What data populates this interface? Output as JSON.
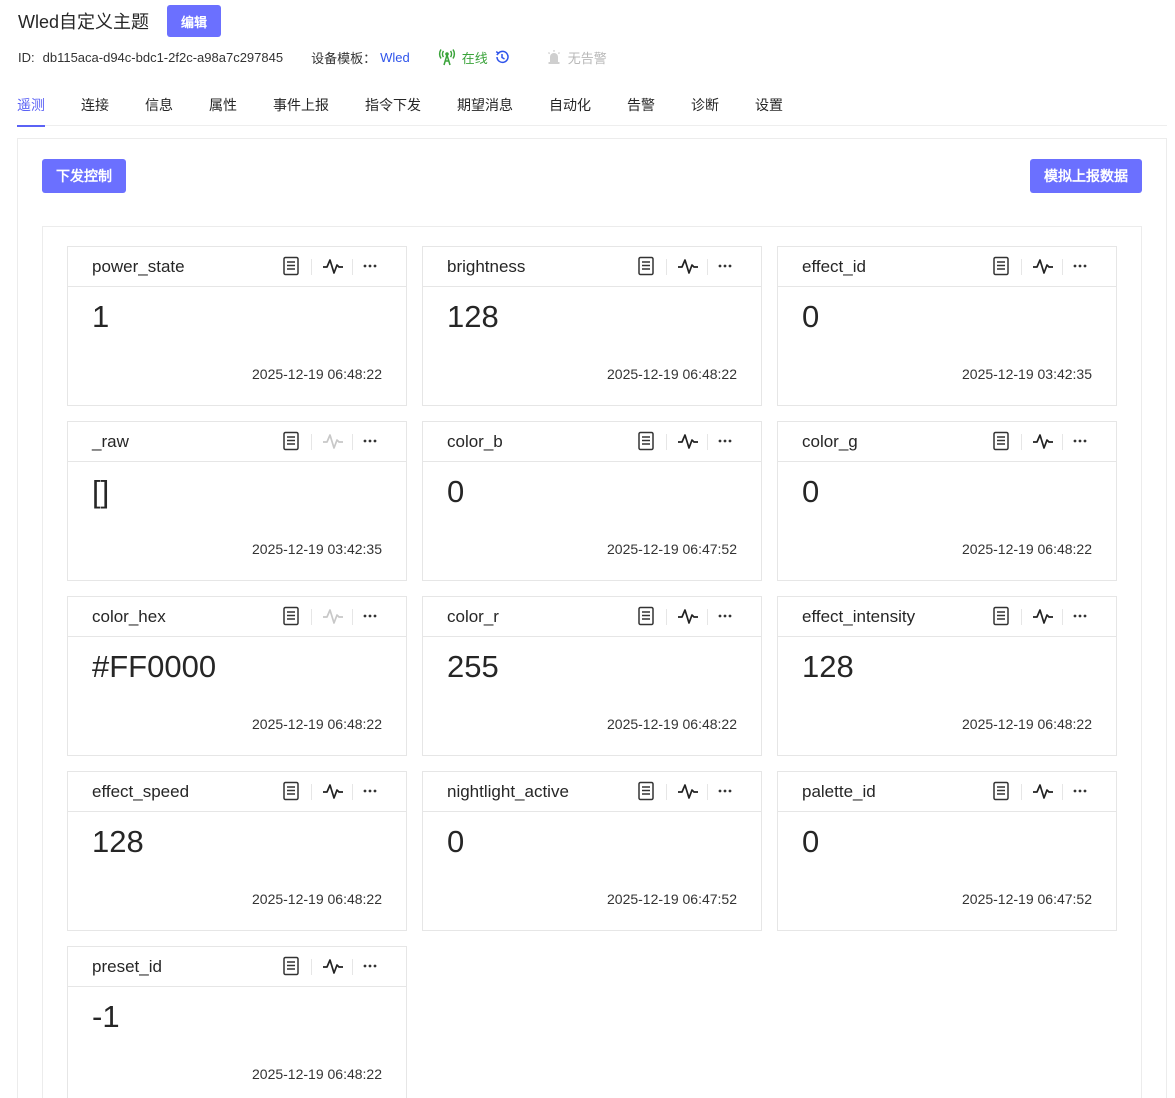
{
  "header": {
    "title": "Wled自定义主题",
    "edit_label": "编辑"
  },
  "meta": {
    "id_label": "ID:",
    "id_value": "db115aca-d94c-bdc1-2f2c-a98a7c297845",
    "template_label": "设备模板：",
    "template_value": "Wled",
    "online_label": "在线",
    "alarm_label": "无告警",
    "colors": {
      "accent": "#6b70ff",
      "online": "#3aa33a",
      "link": "#2f54eb",
      "muted": "#b8b8b8"
    }
  },
  "tabs": [
    {
      "label": "遥测",
      "active": true
    },
    {
      "label": "连接"
    },
    {
      "label": "信息"
    },
    {
      "label": "属性"
    },
    {
      "label": "事件上报"
    },
    {
      "label": "指令下发"
    },
    {
      "label": "期望消息"
    },
    {
      "label": "自动化"
    },
    {
      "label": "告警"
    },
    {
      "label": "诊断"
    },
    {
      "label": "设置"
    }
  ],
  "actions": {
    "send_control": "下发控制",
    "simulate_report": "模拟上报数据"
  },
  "cards": [
    {
      "name": "power_state",
      "value": "1",
      "time": "2025-12-19 06:48:22",
      "chart_enabled": true
    },
    {
      "name": "brightness",
      "value": "128",
      "time": "2025-12-19 06:48:22",
      "chart_enabled": true
    },
    {
      "name": "effect_id",
      "value": "0",
      "time": "2025-12-19 03:42:35",
      "chart_enabled": true
    },
    {
      "name": "_raw",
      "value": "[]",
      "time": "2025-12-19 03:42:35",
      "chart_enabled": false
    },
    {
      "name": "color_b",
      "value": "0",
      "time": "2025-12-19 06:47:52",
      "chart_enabled": true
    },
    {
      "name": "color_g",
      "value": "0",
      "time": "2025-12-19 06:48:22",
      "chart_enabled": true
    },
    {
      "name": "color_hex",
      "value": "#FF0000",
      "time": "2025-12-19 06:48:22",
      "chart_enabled": false
    },
    {
      "name": "color_r",
      "value": "255",
      "time": "2025-12-19 06:48:22",
      "chart_enabled": true
    },
    {
      "name": "effect_intensity",
      "value": "128",
      "time": "2025-12-19 06:48:22",
      "chart_enabled": true
    },
    {
      "name": "effect_speed",
      "value": "128",
      "time": "2025-12-19 06:48:22",
      "chart_enabled": true
    },
    {
      "name": "nightlight_active",
      "value": "0",
      "time": "2025-12-19 06:47:52",
      "chart_enabled": true
    },
    {
      "name": "palette_id",
      "value": "0",
      "time": "2025-12-19 06:47:52",
      "chart_enabled": true
    },
    {
      "name": "preset_id",
      "value": "-1",
      "time": "2025-12-19 06:48:22",
      "chart_enabled": true
    }
  ]
}
